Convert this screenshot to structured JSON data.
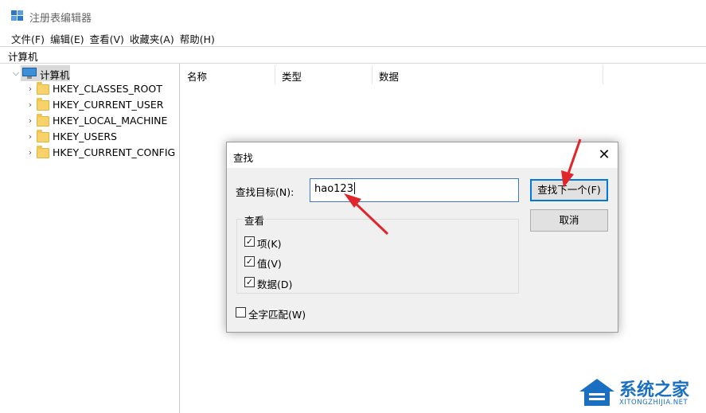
{
  "window": {
    "title": "注册表编辑器"
  },
  "menu": [
    "文件(F)",
    "编辑(E)",
    "查看(V)",
    "收藏夹(A)",
    "帮助(H)"
  ],
  "address": "计算机",
  "tree": {
    "root": "计算机",
    "children": [
      "HKEY_CLASSES_ROOT",
      "HKEY_CURRENT_USER",
      "HKEY_LOCAL_MACHINE",
      "HKEY_USERS",
      "HKEY_CURRENT_CONFIG"
    ]
  },
  "columns": {
    "name": "名称",
    "type": "类型",
    "data": "数据"
  },
  "find_dialog": {
    "title": "查找",
    "target_label": "查找目标(N):",
    "target_value": "hao123",
    "find_next_label": "查找下一个(F)",
    "cancel_label": "取消",
    "look_at_label": "查看",
    "options": [
      {
        "label": "项(K)",
        "checked": true
      },
      {
        "label": "值(V)",
        "checked": true
      },
      {
        "label": "数据(D)",
        "checked": true
      }
    ],
    "match_whole": {
      "label": "全字匹配(W)",
      "checked": false
    }
  },
  "annotation_color": "#e0262b",
  "watermark": {
    "text": "系统之家",
    "url": "XITONGZHIJIA.NET"
  }
}
